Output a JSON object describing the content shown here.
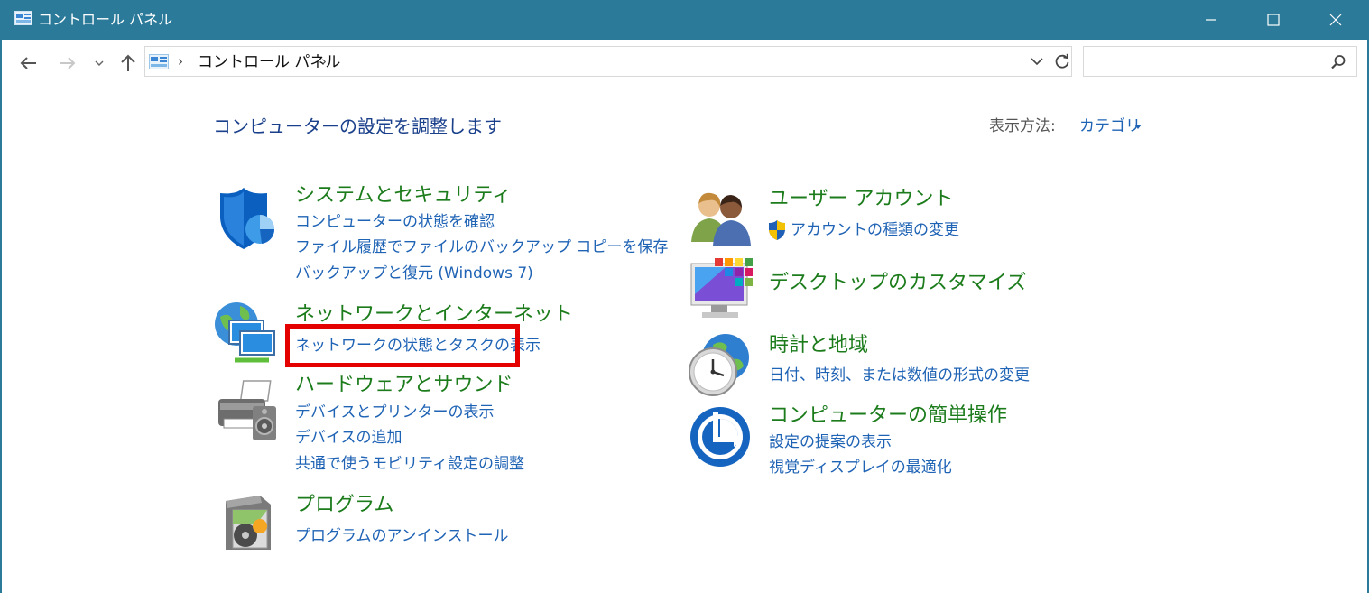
{
  "window": {
    "title": "コントロール パネル"
  },
  "address": {
    "path": "コントロール パネル",
    "search_placeholder": ""
  },
  "main": {
    "title": "コンピューターの設定を調整します",
    "view_by_label": "表示方法:",
    "view_by_value": "カテゴリ"
  },
  "categories": {
    "system_security": {
      "title": "システムとセキュリティ",
      "links": [
        "コンピューターの状態を確認",
        "ファイル履歴でファイルのバックアップ コピーを保存",
        "バックアップと復元 (Windows 7)"
      ]
    },
    "network": {
      "title": "ネットワークとインターネット",
      "links": [
        "ネットワークの状態とタスクの表示"
      ]
    },
    "hardware": {
      "title": "ハードウェアとサウンド",
      "links": [
        "デバイスとプリンターの表示",
        "デバイスの追加",
        "共通で使うモビリティ設定の調整"
      ]
    },
    "programs": {
      "title": "プログラム",
      "links": [
        "プログラムのアンインストール"
      ]
    },
    "user_accounts": {
      "title": "ユーザー アカウント",
      "links": [
        "アカウントの種類の変更"
      ]
    },
    "appearance": {
      "title": "デスクトップのカスタマイズ"
    },
    "clock_region": {
      "title": "時計と地域",
      "links": [
        "日付、時刻、または数値の形式の変更"
      ]
    },
    "ease_of_access": {
      "title": "コンピューターの簡単操作",
      "links": [
        "設定の提案の表示",
        "視覚ディスプレイの最適化"
      ]
    }
  },
  "colors": {
    "titlebar": "#2b7a99",
    "heading_green": "#1c7c1c",
    "link_blue": "#1f63b5",
    "page_title": "#1a3f8b",
    "highlight_red": "#e50000"
  },
  "icons": {
    "title": "control-panel-icon",
    "address": "control-panel-icon",
    "system_security": "shield-icon",
    "network": "network-globe-icon",
    "hardware": "printer-icon",
    "programs": "program-disc-icon",
    "user_accounts": "users-icon",
    "uac": "uac-shield-icon",
    "appearance": "desktop-monitor-icon",
    "clock_region": "clock-globe-icon",
    "ease_of_access": "ease-of-access-icon"
  }
}
